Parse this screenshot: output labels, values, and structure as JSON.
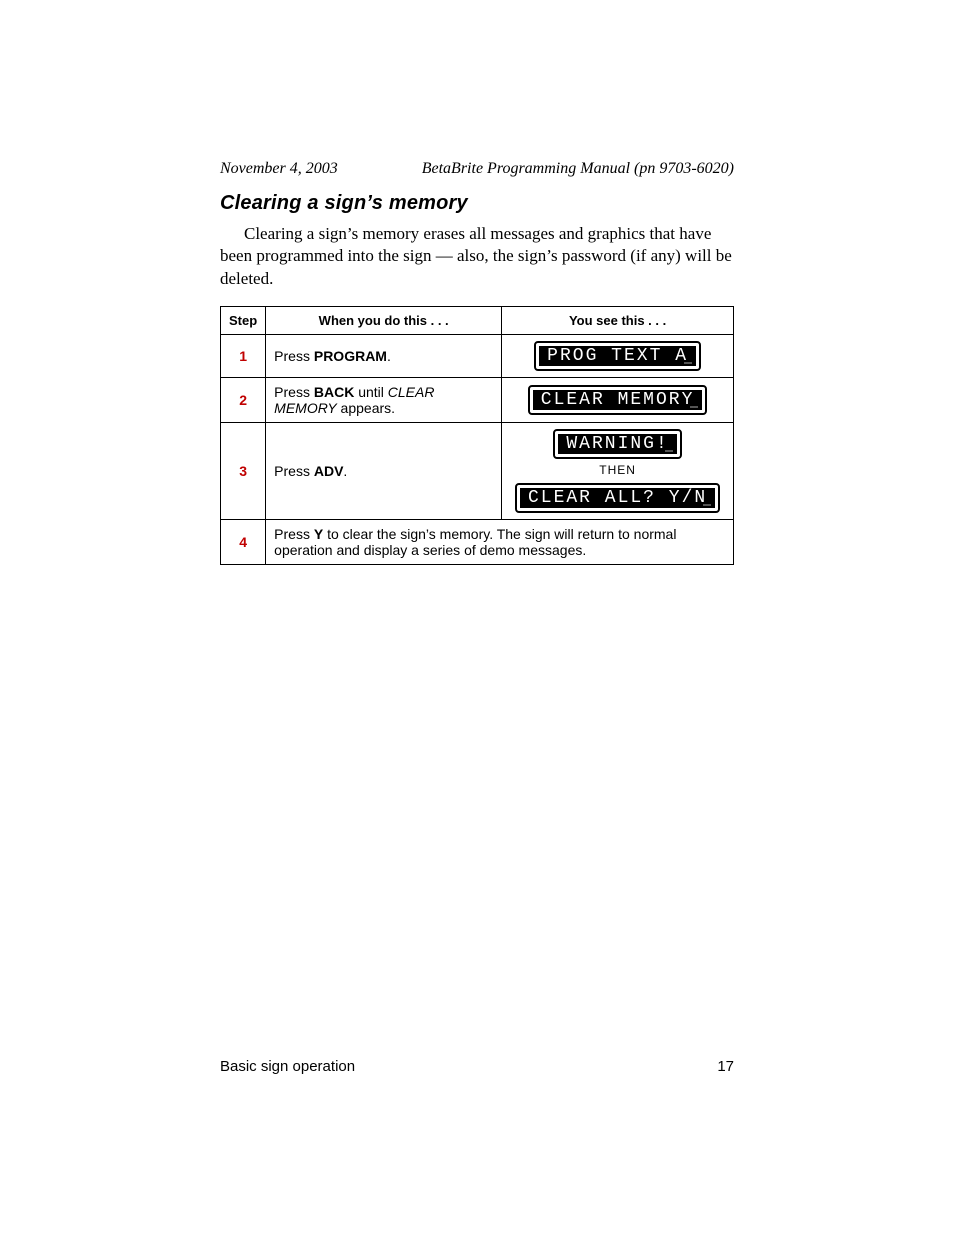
{
  "header": {
    "date": "November 4, 2003",
    "manual": "BetaBrite Programming Manual (pn 9703-6020)"
  },
  "section_title": "Clearing a sign’s memory",
  "intro": "Clearing a sign’s memory erases all messages and graphics that have been programmed into the sign — also, the sign’s password (if any) will be deleted.",
  "table": {
    "headers": {
      "step": "Step",
      "do": "When you do this . . .",
      "see": "You see this . . ."
    },
    "rows": [
      {
        "num": "1",
        "do_parts": [
          "Press ",
          "PROGRAM",
          "."
        ],
        "signs": [
          "PROG TEXT A"
        ]
      },
      {
        "num": "2",
        "do_parts": [
          "Press ",
          "BACK",
          " until ",
          "CLEAR MEMORY",
          " appears."
        ],
        "do_emph_idx": {
          "bold": [
            1
          ],
          "italic": [
            3
          ]
        },
        "signs": [
          "CLEAR MEMORY"
        ]
      },
      {
        "num": "3",
        "do_parts": [
          "Press ",
          "ADV",
          "."
        ],
        "signs": [
          "WARNING!",
          "CLEAR ALL? Y/N"
        ],
        "then_label": "THEN"
      },
      {
        "num": "4",
        "full_row_parts": [
          "Press ",
          "Y",
          " to clear the sign’s memory. The sign will return to normal operation and display a series of demo messages."
        ]
      }
    ]
  },
  "footer": {
    "section": "Basic sign operation",
    "page": "17"
  }
}
